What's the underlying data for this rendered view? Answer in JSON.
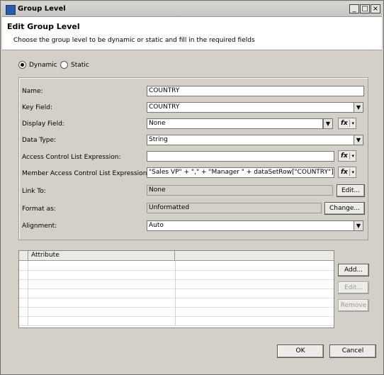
{
  "window": {
    "title": "Group Level",
    "min_label": "_",
    "max_label": "□",
    "close_label": "×"
  },
  "header": {
    "title": "Edit Group Level",
    "description": "Choose the group level to be dynamic or static and fill in the required fields"
  },
  "mode": {
    "dynamic_label": "Dynamic",
    "static_label": "Static",
    "selected": "Dynamic"
  },
  "form": {
    "name_label": "Name:",
    "name_value": "COUNTRY",
    "key_field_label": "Key Field:",
    "key_field_value": "COUNTRY",
    "display_field_label": "Display Field:",
    "display_field_value": "None",
    "data_type_label": "Data Type:",
    "data_type_value": "String",
    "acl_label": "Access Control List Expression:",
    "acl_value": "",
    "macl_label": "Member Access Control List Expression:",
    "macl_value": "\"Sales VP\" + \",\" + \"Manager \" + dataSetRow[\"COUNTRY\"]",
    "link_to_label": "Link To:",
    "link_to_value": "None",
    "format_as_label": "Format as:",
    "format_as_value": "Unformatted",
    "alignment_label": "Alignment:",
    "alignment_value": "Auto"
  },
  "buttons": {
    "fx": "fx",
    "dropdown_arrow": "▼",
    "fx_arrow": "▾",
    "edit_link": "Edit...",
    "change": "Change...",
    "add": "Add...",
    "edit": "Edit...",
    "remove": "Remove",
    "ok": "OK",
    "cancel": "Cancel"
  },
  "attributes_table": {
    "columns": [
      "Attribute",
      ""
    ],
    "rows": []
  }
}
